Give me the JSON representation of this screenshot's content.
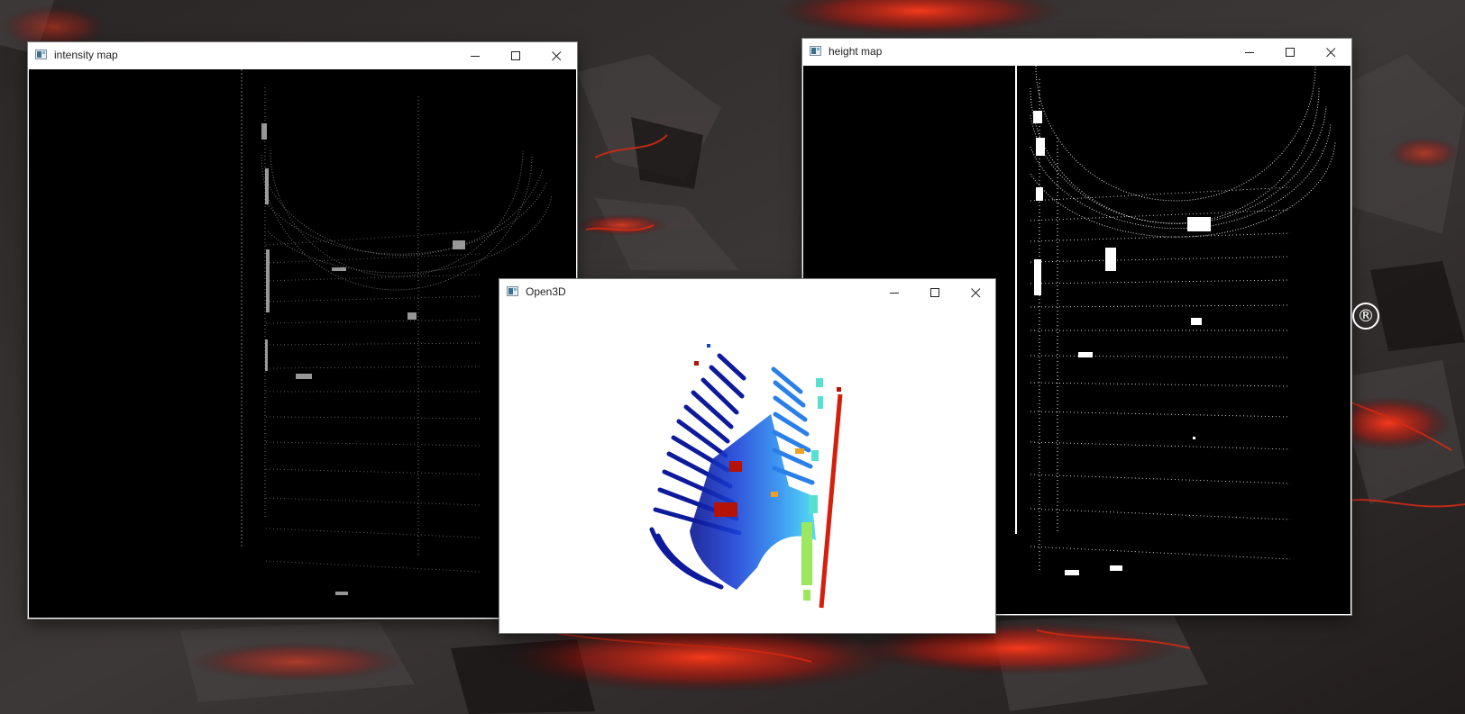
{
  "windows": {
    "intensity": {
      "title": "intensity map"
    },
    "height": {
      "title": "height map"
    },
    "open3d": {
      "title": "Open3D"
    }
  },
  "desktop": {
    "registered_mark": "®"
  },
  "colors": {
    "desktop_dark": "#1a1414",
    "lava_red": "#d0200e",
    "titlebar": "#ffffff",
    "image_background": "#000000",
    "viewer_background": "#ffffff"
  },
  "icons": [
    "app-window-icon",
    "minimize-icon",
    "maximize-icon",
    "close-icon"
  ]
}
